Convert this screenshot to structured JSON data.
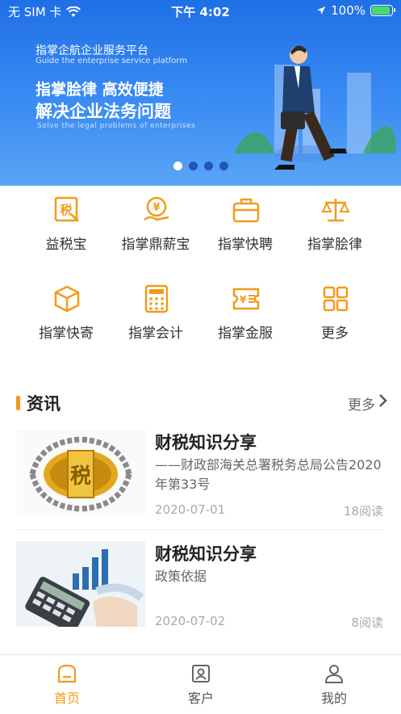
{
  "status_bar": {
    "carrier": "无 SIM 卡",
    "time": "下午 4:02",
    "battery": "100%"
  },
  "banner": {
    "platform_name": "指掌企航企业服务平台",
    "platform_name_en": "Guide the enterprise service platform",
    "headline1": "指掌脍律  高效便捷",
    "headline2": "解决企业法务问题",
    "headline_en": "Solve the legal problems of enterprises",
    "slide_count": 4,
    "active_slide": 1
  },
  "services": [
    {
      "label": "益税宝",
      "icon": "tax-icon"
    },
    {
      "label": "指掌鼎薪宝",
      "icon": "salary-icon"
    },
    {
      "label": "指掌快聘",
      "icon": "briefcase-icon"
    },
    {
      "label": "指掌脍律",
      "icon": "scale-icon"
    },
    {
      "label": "指掌快寄",
      "icon": "package-icon"
    },
    {
      "label": "指掌会计",
      "icon": "calculator-icon"
    },
    {
      "label": "指掌金服",
      "icon": "ticket-yuan-icon"
    },
    {
      "label": "更多",
      "icon": "grid-icon"
    }
  ],
  "news": {
    "title": "资讯",
    "more": "更多",
    "articles": [
      {
        "title": "财税知识分享",
        "desc": "——财政部海关总署税务总局公告2020年第33号",
        "date": "2020-07-01",
        "reads": "18阅读"
      },
      {
        "title": "财税知识分享",
        "desc": "政策依据",
        "date": "2020-07-02",
        "reads": "8阅读"
      }
    ]
  },
  "tabbar": {
    "items": [
      {
        "label": "首页",
        "icon": "home-icon",
        "active": true
      },
      {
        "label": "客户",
        "icon": "contact-card-icon",
        "active": false
      },
      {
        "label": "我的",
        "icon": "user-icon",
        "active": false
      }
    ]
  },
  "colors": {
    "accent": "#f39a1a",
    "banner_blue": "#2f7ff0"
  }
}
